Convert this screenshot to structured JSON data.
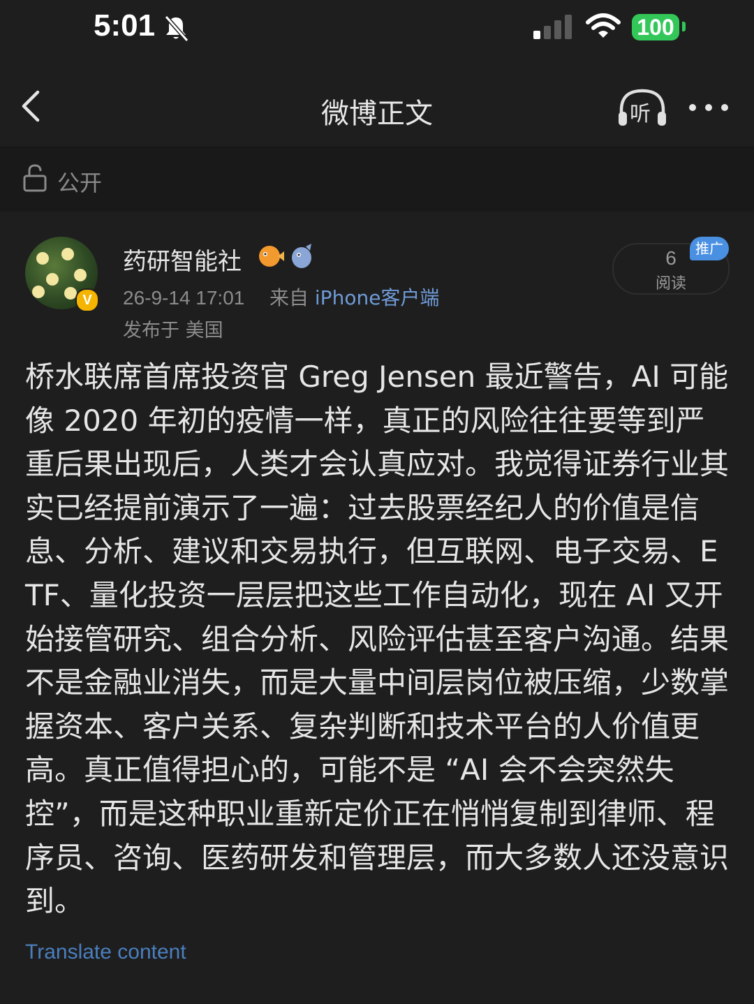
{
  "status_bar": {
    "time": "5:01",
    "battery": "100",
    "icons": [
      "bell-slash-icon",
      "signal-icon",
      "wifi-icon",
      "battery-icon"
    ]
  },
  "nav": {
    "title": "微博正文",
    "listen_label": "听",
    "icons": [
      "chevron-left-icon",
      "headphones-icon",
      "more-icon"
    ]
  },
  "visibility": {
    "label": "公开",
    "icon": "unlock-icon"
  },
  "post": {
    "username": "药研智能社",
    "verified_mark": "V",
    "timestamp": "26-9-14 17:01",
    "source_prefix": "来自",
    "source": "iPhone客户端",
    "location": "发布于 美国",
    "read_count": "6",
    "read_label": "阅读",
    "promote_label": "推广",
    "body": "桥水联席首席投资官 Greg Jensen 最近警告，AI 可能像 2020 年初的疫情一样，真正的风险往往要等到严重后果出现后，人类才会认真应对。我觉得证券行业其实已经提前演示了一遍：过去股票经纪人的价值是信息、分析、建议和交易执行，但互联网、电子交易、ETF、量化投资一层层把这些工作自动化，现在 AI 又开始接管研究、组合分析、风险评估甚至客户沟通。结果不是金融业消失，而是大量中间层岗位被压缩，少数掌握资本、客户关系、复杂判断和技术平台的人价值更高。真正值得担心的，可能不是 “AI 会不会突然失控”，而是这种职业重新定价正在悄悄复制到律师、程序员、咨询、医药研发和管理层，而大多数人还没意识到。",
    "translate_label": "Translate content"
  },
  "colors": {
    "background": "#191919",
    "panel": "#1e1e1e",
    "link": "#6f9bd8",
    "battery": "#33c759",
    "promote": "#4a90e2",
    "verified": "#f5b400"
  }
}
